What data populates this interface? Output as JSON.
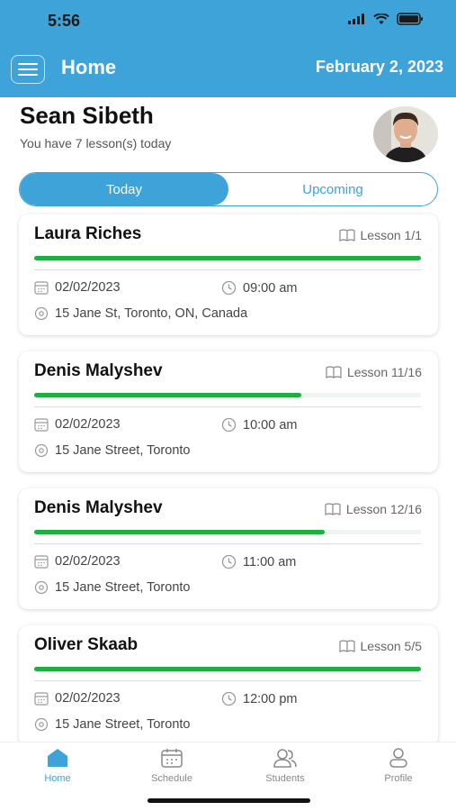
{
  "status": {
    "time": "5:56"
  },
  "header": {
    "title": "Home",
    "date": "February 2, 2023",
    "menu_icon": "hamburger-menu-icon"
  },
  "user": {
    "name": "Sean Sibeth",
    "lessons_today": "You have 7 lesson(s) today"
  },
  "tabs": {
    "today": "Today",
    "upcoming": "Upcoming",
    "selected": "Today"
  },
  "lessons": [
    {
      "student": "Laura Riches",
      "lesson": "Lesson 1/1",
      "progress": 1.0,
      "date": "02/02/2023",
      "time": "09:00 am",
      "address": "15 Jane St, Toronto, ON, Canada"
    },
    {
      "student": "Denis Malyshev",
      "lesson": "Lesson 11/16",
      "progress": 0.69,
      "date": "02/02/2023",
      "time": "10:00 am",
      "address": "15 Jane Street, Toronto"
    },
    {
      "student": "Denis Malyshev",
      "lesson": "Lesson 12/16",
      "progress": 0.75,
      "date": "02/02/2023",
      "time": "11:00 am",
      "address": "15 Jane Street, Toronto"
    },
    {
      "student": "Oliver Skaab",
      "lesson": "Lesson 5/5",
      "progress": 1.0,
      "date": "02/02/2023",
      "time": "12:00 pm",
      "address": "15 Jane Street, Toronto"
    }
  ],
  "bottom_nav": [
    {
      "label": "Home",
      "icon": "home-icon",
      "active": true
    },
    {
      "label": "Schedule",
      "icon": "calendar-icon",
      "active": false
    },
    {
      "label": "Students",
      "icon": "students-icon",
      "active": false
    },
    {
      "label": "Profile",
      "icon": "profile-icon",
      "active": false
    }
  ],
  "colors": {
    "primary": "#3da3d9",
    "progress": "#1fae3f"
  }
}
